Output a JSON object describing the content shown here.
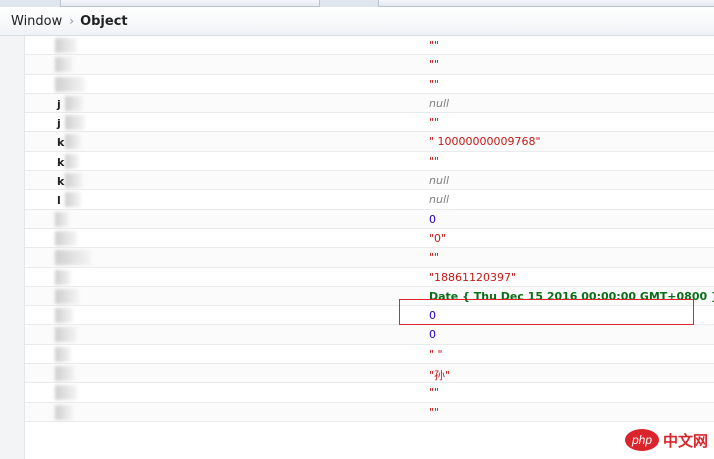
{
  "breadcrumb": {
    "root": "Window",
    "current": "Object"
  },
  "rows": [
    {
      "key": "",
      "value": "\"\"",
      "kind": "str"
    },
    {
      "key": "",
      "value": "\"\"",
      "kind": "str"
    },
    {
      "key": "",
      "value": "\"\"",
      "kind": "str"
    },
    {
      "key": "j",
      "value": "null",
      "kind": "null"
    },
    {
      "key": "j",
      "value": "\"\"",
      "kind": "str"
    },
    {
      "key": "k",
      "value": "\" 10000000009768\"",
      "kind": "str"
    },
    {
      "key": "k",
      "value": "\"\"",
      "kind": "str"
    },
    {
      "key": "k",
      "value": "null",
      "kind": "null"
    },
    {
      "key": "l",
      "value": "null",
      "kind": "null"
    },
    {
      "key": "",
      "value": "0",
      "kind": "num"
    },
    {
      "key": "",
      "value": "\"0\"",
      "kind": "str"
    },
    {
      "key": "",
      "value": "\"\"",
      "kind": "str"
    },
    {
      "key": "",
      "value": "\"18861120397\"",
      "kind": "str"
    },
    {
      "key": "",
      "value": "Date { Thu Dec 15 2016 00:00:00 GMT+0800 }",
      "kind": "date"
    },
    {
      "key": "",
      "value": "0",
      "kind": "num"
    },
    {
      "key": "",
      "value": "0",
      "kind": "num"
    },
    {
      "key": "",
      "value": "\" \"",
      "kind": "str"
    },
    {
      "key": "",
      "value": "\"孙\"",
      "kind": "str"
    },
    {
      "key": "",
      "value": "\"\"",
      "kind": "str"
    },
    {
      "key": "",
      "value": "\"\"",
      "kind": "str"
    }
  ],
  "watermark": {
    "logo": "php",
    "text": "中文网"
  },
  "colors": {
    "string": "#c41a16",
    "null": "#808080",
    "number": "#1c00cf",
    "date": "#0b6e18",
    "highlight": "#e0242a"
  }
}
